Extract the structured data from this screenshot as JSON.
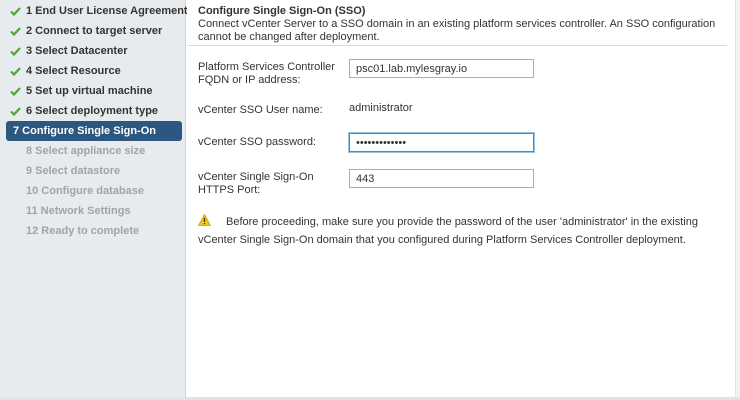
{
  "sidebar": {
    "steps": [
      {
        "label": "1 End User License Agreement",
        "state": "done"
      },
      {
        "label": "2 Connect to target server",
        "state": "done"
      },
      {
        "label": "3 Select Datacenter",
        "state": "done"
      },
      {
        "label": "4 Select Resource",
        "state": "done"
      },
      {
        "label": "5 Set up virtual machine",
        "state": "done"
      },
      {
        "label": "6 Select deployment type",
        "state": "done"
      },
      {
        "label": "7 Configure Single Sign-On",
        "state": "active"
      },
      {
        "label": "8 Select appliance size",
        "state": "future"
      },
      {
        "label": "9 Select datastore",
        "state": "future"
      },
      {
        "label": "10 Configure database",
        "state": "future"
      },
      {
        "label": "11 Network Settings",
        "state": "future"
      },
      {
        "label": "12 Ready to complete",
        "state": "future"
      }
    ]
  },
  "main": {
    "title": "Configure Single Sign-On (SSO)",
    "subtitle": "Connect vCenter Server to a SSO domain in an existing platform services controller. An SSO configuration cannot be changed after deployment.",
    "fields": {
      "psc_label": "Platform Services Controller FQDN or IP address:",
      "psc_value": "psc01.lab.mylesgray.io",
      "sso_user_label": "vCenter SSO User name:",
      "sso_user_value": "administrator",
      "sso_password_label": "vCenter SSO password:",
      "sso_password_value": "•••••••••••••",
      "https_port_label": "vCenter Single Sign-On HTTPS Port:",
      "https_port_value": "443"
    },
    "warning": {
      "icon": "warning-icon",
      "text": "Before proceeding, make sure you provide the password of the user 'administrator' in the existing vCenter Single Sign-On domain that you configured during Platform Services Controller deployment."
    }
  },
  "colors": {
    "sidebar_bg": "#e8ebee",
    "active_step_bg": "#2c5781",
    "check_green": "#52a534",
    "future_text": "#a0a4a8",
    "warning_yellow": "#f2c318"
  }
}
